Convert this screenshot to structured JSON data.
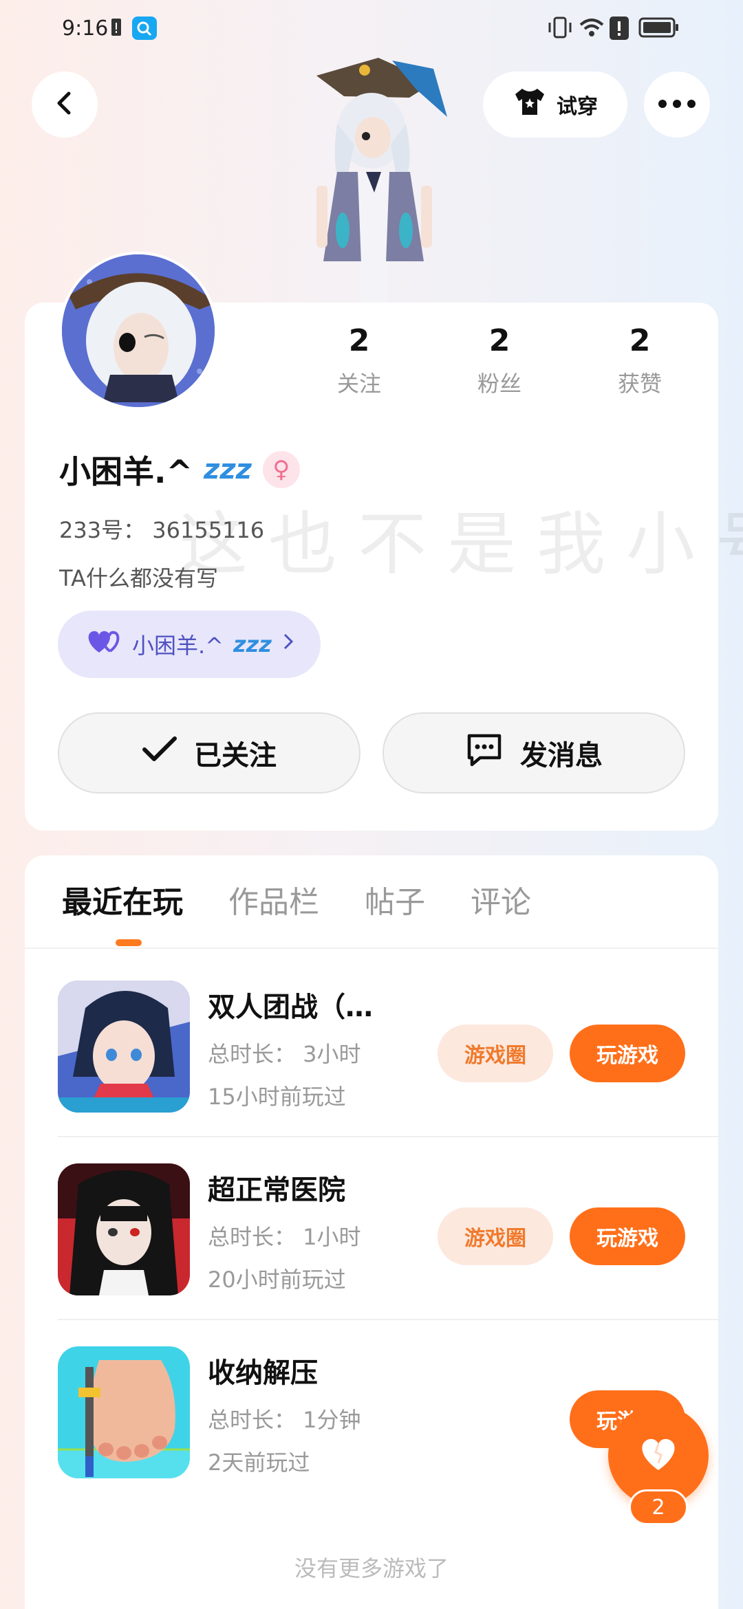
{
  "status_bar": {
    "time": "9:16"
  },
  "header": {
    "tryon_label": "试穿"
  },
  "profile": {
    "stats": [
      {
        "value": "2",
        "label": "关注"
      },
      {
        "value": "2",
        "label": "粉丝"
      },
      {
        "value": "2",
        "label": "获赞"
      }
    ],
    "username": "小困羊.^",
    "username_suffix": "zzz",
    "uid": "233号： 36155116",
    "bio": "TA什么都没有写",
    "watermark": "这也不是我小号",
    "cp_name": "小困羊.^",
    "cp_suffix": "zzz",
    "follow_label": "已关注",
    "message_label": "发消息"
  },
  "tabs": [
    "最近在玩",
    "作品栏",
    "帖子",
    "评论"
  ],
  "games": [
    {
      "name": "双人团战（…",
      "duration": "总时长： 3小时",
      "last_played": "15小时前玩过",
      "circle_label": "游戏圈",
      "play_label": "玩游戏"
    },
    {
      "name": "超正常医院",
      "duration": "总时长： 1小时",
      "last_played": "20小时前玩过",
      "circle_label": "游戏圈",
      "play_label": "玩游戏"
    },
    {
      "name": "收纳解压",
      "duration": "总时长： 1分钟",
      "last_played": "2天前玩过",
      "play_label": "玩游戏"
    }
  ],
  "footer": "没有更多游戏了",
  "like_count": "2",
  "colors": {
    "accent": "#ff6f1a",
    "cp_bg": "#e8e6fb"
  }
}
